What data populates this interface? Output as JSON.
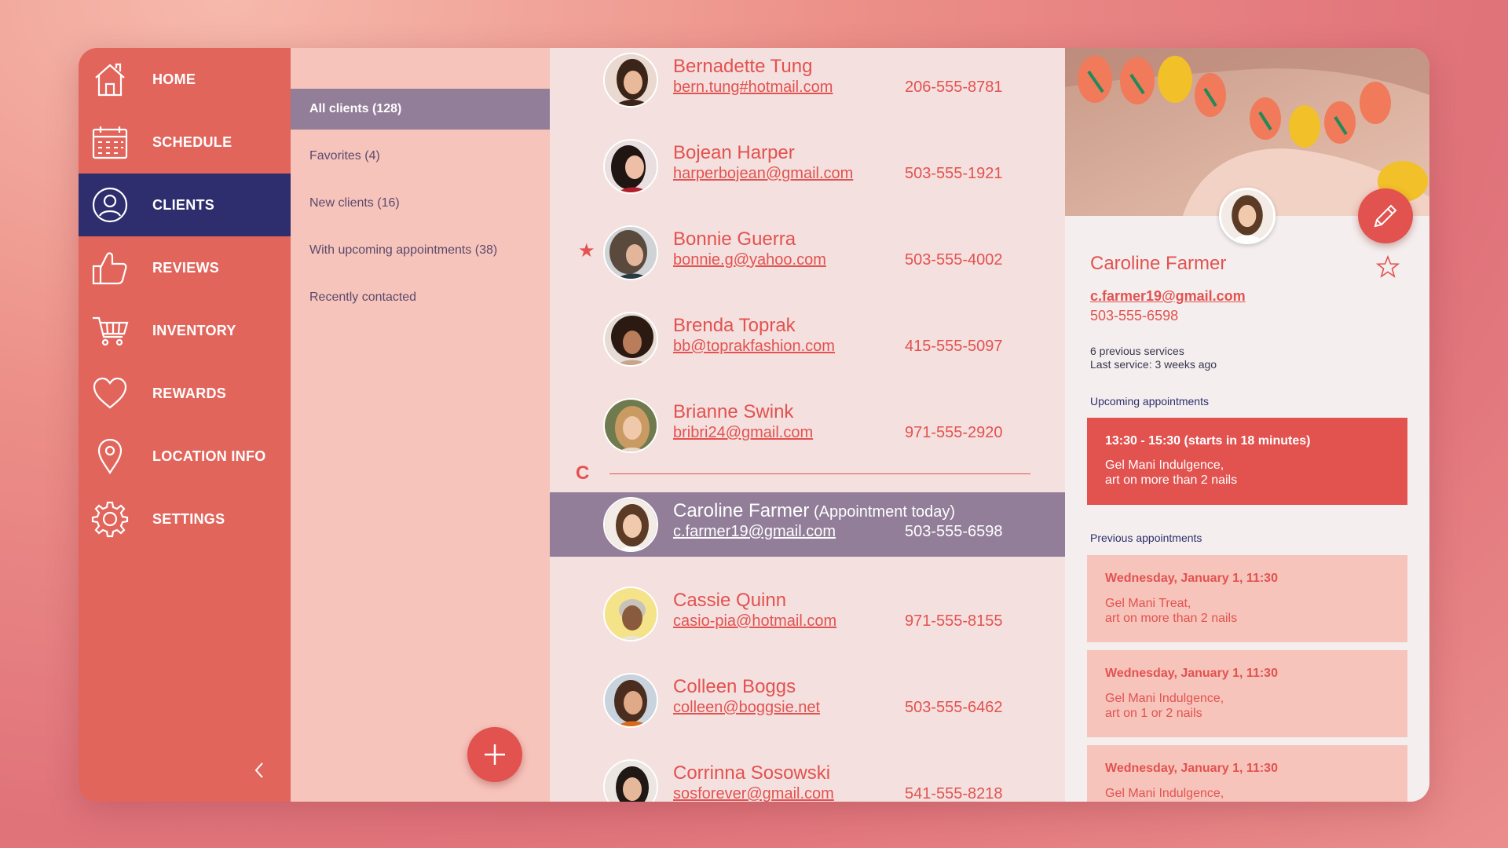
{
  "nav": {
    "items": [
      {
        "label": "HOME",
        "icon": "home-icon"
      },
      {
        "label": "SCHEDULE",
        "icon": "calendar-icon"
      },
      {
        "label": "CLIENTS",
        "icon": "user-icon"
      },
      {
        "label": "REVIEWS",
        "icon": "thumbs-up-icon"
      },
      {
        "label": "INVENTORY",
        "icon": "cart-icon"
      },
      {
        "label": "REWARDS",
        "icon": "heart-icon"
      },
      {
        "label": "LOCATION INFO",
        "icon": "location-pin-icon"
      },
      {
        "label": "SETTINGS",
        "icon": "gear-icon"
      }
    ],
    "active": "CLIENTS"
  },
  "filters": {
    "items": [
      {
        "label": "All clients (128)"
      },
      {
        "label": "Favorites (4)"
      },
      {
        "label": "New clients (16)"
      },
      {
        "label": "With upcoming appointments (38)"
      },
      {
        "label": "Recently contacted"
      }
    ],
    "active": "All clients (128)"
  },
  "clients": {
    "rows": [
      {
        "name": "Bernadette Tung",
        "email": "bern.tung#hotmail.com",
        "phone": "206-555-8781"
      },
      {
        "name": "Bojean Harper",
        "email": "harperbojean@gmail.com",
        "phone": "503-555-1921"
      },
      {
        "name": "Bonnie Guerra",
        "email": "bonnie.g@yahoo.com",
        "phone": "503-555-4002",
        "favorite": "★"
      },
      {
        "name": "Brenda Toprak",
        "email": "bb@toprakfashion.com",
        "phone": "415-555-5097"
      },
      {
        "name": "Brianne Swink",
        "email": "bribri24@gmail.com",
        "phone": "971-555-2920"
      },
      {
        "name": "Caroline Farmer",
        "note": " (Appointment today)",
        "email": "c.farmer19@gmail.com",
        "phone": "503-555-6598"
      },
      {
        "name": "Cassie Quinn",
        "email": "casio-pia@hotmail.com",
        "phone": "971-555-8155"
      },
      {
        "name": "Colleen Boggs",
        "email": "colleen@boggsie.net",
        "phone": "503-555-6462"
      },
      {
        "name": "Corrinna Sosowski",
        "email": "sosforever@gmail.com",
        "phone": "541-555-8218"
      }
    ],
    "section_letter": "C"
  },
  "detail": {
    "name": "Caroline Farmer",
    "email": "c.farmer19@gmail.com",
    "phone": "503-555-6598",
    "services": "6 previous services",
    "last_service": "Last service: 3 weeks ago",
    "upcoming_title": "Upcoming appointments",
    "upcoming": {
      "time": "13:30 - 15:30 (starts in 18 minutes)",
      "line1": "Gel Mani Indulgence,",
      "line2": "art on more than 2 nails"
    },
    "previous_title": "Previous appointments",
    "previous": [
      {
        "time": "Wednesday, January 1, 11:30",
        "line1": "Gel Mani Treat,",
        "line2": "art on more than 2 nails"
      },
      {
        "time": "Wednesday, January 1, 11:30",
        "line1": "Gel Mani Indulgence,",
        "line2": "art on 1 or 2 nails"
      },
      {
        "time": "Wednesday, January 1, 11:30",
        "line1": "Gel Mani Indulgence,",
        "line2": ""
      }
    ]
  },
  "colors": {
    "accent": "#e2524f",
    "sidebar": "#e2655c",
    "active_nav": "#2e2d6e",
    "selected_row": "#927e99"
  }
}
